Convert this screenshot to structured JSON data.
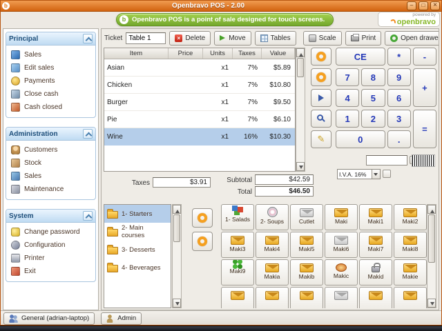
{
  "window": {
    "title": "Openbravo POS - 2.00",
    "banner_text": "Openbravo POS is a point of sale designed for touch screens.",
    "brand": {
      "powered_by": "powered by",
      "name": "openbravo"
    }
  },
  "sidebar": {
    "sections": [
      {
        "title": "Principal",
        "items": [
          {
            "label": "Sales",
            "icon": "sales-icon"
          },
          {
            "label": "Edit sales",
            "icon": "edit-sales-icon"
          },
          {
            "label": "Payments",
            "icon": "payments-icon"
          },
          {
            "label": "Close cash",
            "icon": "close-cash-icon"
          },
          {
            "label": "Cash closed",
            "icon": "cash-closed-icon"
          }
        ]
      },
      {
        "title": "Administration",
        "items": [
          {
            "label": "Customers",
            "icon": "customers-icon"
          },
          {
            "label": "Stock",
            "icon": "stock-icon"
          },
          {
            "label": "Sales",
            "icon": "sales-report-icon"
          },
          {
            "label": "Maintenance",
            "icon": "maintenance-icon"
          }
        ]
      },
      {
        "title": "System",
        "items": [
          {
            "label": "Change password",
            "icon": "password-icon"
          },
          {
            "label": "Configuration",
            "icon": "configuration-icon"
          },
          {
            "label": "Printer",
            "icon": "printer-icon"
          },
          {
            "label": "Exit",
            "icon": "exit-icon"
          }
        ]
      }
    ]
  },
  "toolbar": {
    "ticket_label": "Ticket",
    "ticket_value": "Table 1",
    "delete_label": "Delete",
    "move_label": "Move",
    "tables_label": "Tables",
    "scale_label": "Scale",
    "print_label": "Print",
    "open_drawer_label": "Open drawer"
  },
  "receipt": {
    "columns": [
      "Item",
      "Price",
      "Units",
      "Taxes",
      "Value"
    ],
    "rows": [
      {
        "item": "Asian",
        "price": "",
        "units": "x1",
        "taxes": "7%",
        "value": "$5.89",
        "selected": false
      },
      {
        "item": "Chicken",
        "price": "",
        "units": "x1",
        "taxes": "7%",
        "value": "$10.80",
        "selected": false
      },
      {
        "item": "Burger",
        "price": "",
        "units": "x1",
        "taxes": "7%",
        "value": "$9.50",
        "selected": false
      },
      {
        "item": "Pie",
        "price": "",
        "units": "x1",
        "taxes": "7%",
        "value": "$6.10",
        "selected": false
      },
      {
        "item": "Wine",
        "price": "",
        "units": "x1",
        "taxes": "16%",
        "value": "$10.30",
        "selected": true
      }
    ]
  },
  "keypad": {
    "keys": [
      "CE",
      "*",
      "-",
      "7",
      "8",
      "9",
      "+",
      "4",
      "5",
      "6",
      "1",
      "2",
      "3",
      "=",
      "0",
      "."
    ],
    "aux_icons": [
      "circle-icon",
      "circle-icon",
      "sign-icon",
      "search-icon",
      "edit-icon"
    ],
    "input_value": "",
    "tax_selected": "I.V.A. 16%"
  },
  "totals": {
    "taxes_label": "Taxes",
    "taxes_value": "$3.91",
    "subtotal_label": "Subtotal",
    "subtotal_value": "$42.59",
    "total_label": "Total",
    "total_value": "$46.50"
  },
  "catalog": {
    "categories": [
      {
        "label": "1- Starters",
        "selected": true
      },
      {
        "label": "2- Main courses",
        "selected": false
      },
      {
        "label": "3- Desserts",
        "selected": false
      },
      {
        "label": "4- Beverages",
        "selected": false
      }
    ],
    "products": [
      {
        "label": "1- Salads",
        "icon": "cubes"
      },
      {
        "label": "2- Soups",
        "icon": "disc"
      },
      {
        "label": "Cutlet",
        "icon": "package-light"
      },
      {
        "label": "Maki",
        "icon": "package"
      },
      {
        "label": "Maki1",
        "icon": "package"
      },
      {
        "label": "Maki2",
        "icon": "package"
      },
      {
        "label": "Maki3",
        "icon": "package"
      },
      {
        "label": "Maki4",
        "icon": "package"
      },
      {
        "label": "Maki5",
        "icon": "package"
      },
      {
        "label": "Maki6",
        "icon": "package-light"
      },
      {
        "label": "Maki7",
        "icon": "package"
      },
      {
        "label": "Maki8",
        "icon": "package"
      },
      {
        "label": "Maki9",
        "icon": "clover"
      },
      {
        "label": "Makia",
        "icon": "package"
      },
      {
        "label": "Makib",
        "icon": "package"
      },
      {
        "label": "Makic",
        "icon": "dish"
      },
      {
        "label": "Makid",
        "icon": "lock"
      },
      {
        "label": "Makie",
        "icon": "package"
      },
      {
        "label": "",
        "icon": "package"
      },
      {
        "label": "",
        "icon": "package"
      },
      {
        "label": "",
        "icon": "package"
      },
      {
        "label": "",
        "icon": "package-light"
      },
      {
        "label": "",
        "icon": "package"
      },
      {
        "label": "",
        "icon": "package"
      }
    ]
  },
  "statusbar": {
    "user_tab": "General (adrian-laptop)",
    "role_tab": "Admin"
  }
}
